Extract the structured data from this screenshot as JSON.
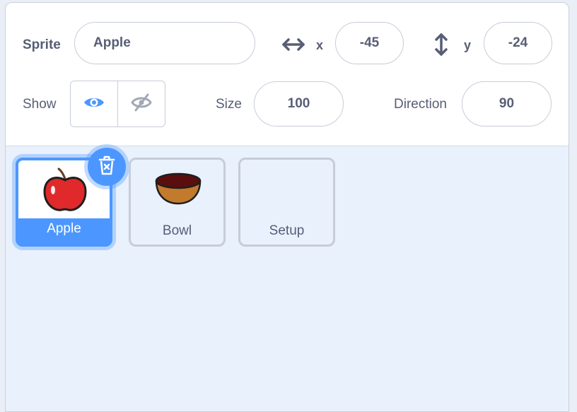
{
  "sprite_info": {
    "sprite_label": "Sprite",
    "sprite_name": "Apple",
    "x_label": "x",
    "x_value": "-45",
    "y_label": "y",
    "y_value": "-24",
    "show_label": "Show",
    "size_label": "Size",
    "size_value": "100",
    "direction_label": "Direction",
    "direction_value": "90"
  },
  "sprites": [
    {
      "name": "Apple",
      "selected": true,
      "icon": "apple-icon"
    },
    {
      "name": "Bowl",
      "selected": false,
      "icon": "bowl-icon"
    },
    {
      "name": "Setup",
      "selected": false,
      "icon": ""
    }
  ],
  "colors": {
    "accent": "#4c97ff",
    "text": "#575e75",
    "panel_bg": "#e9f1fc",
    "border": "#c7cdd8"
  }
}
